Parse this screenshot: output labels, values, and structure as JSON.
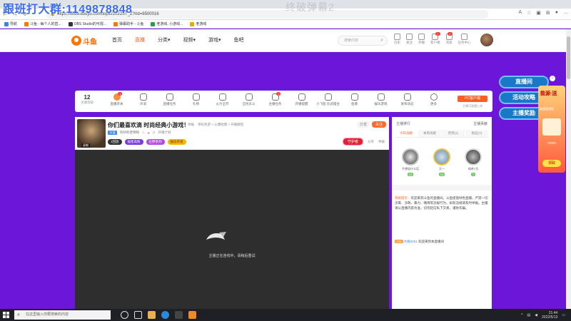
{
  "overlay": {
    "title": "跟班打大群:1149878848",
    "watermark": "终破弹幕2"
  },
  "browser": {
    "url": "https://www.douyu.com/topic/2022ST_Z?rid=8500016",
    "bookmarks": [
      "导航",
      "斗鱼 - 每个人的直...",
      "OBS Studio的可视...",
      "弹幕助手 - 斗鱼",
      "老游戏, 小游戏...",
      "老游戏"
    ]
  },
  "header": {
    "logo_text": "斗鱼",
    "nav": [
      "首页",
      "直播",
      "分类▾",
      "视频▾",
      "游戏▾",
      "鱼吧"
    ],
    "search_placeholder": "搜索内容",
    "user_icons": [
      {
        "label": "历史",
        "badge": ""
      },
      {
        "label": "关注",
        "badge": ""
      },
      {
        "label": "开播",
        "badge": ""
      },
      {
        "label": "客户端",
        "badge": "1"
      },
      {
        "label": "消息",
        "badge": "2"
      },
      {
        "label": "任务中心",
        "badge": ""
      }
    ]
  },
  "side": {
    "buttons": [
      "直播间",
      "活动攻略",
      "主播奖励"
    ],
    "close": "−",
    "promo_title": "能源·送",
    "promo_sub": "能量值领取",
    "promo_count": "0/300",
    "promo_button": "领取"
  },
  "toolbar": {
    "level_num": "12",
    "level_label": "主播等级",
    "items": [
      {
        "label": "直播开关",
        "badge": "1"
      },
      {
        "label": "声浪",
        "badge": ""
      },
      {
        "label": "直播任务",
        "badge": ""
      },
      {
        "label": "礼物",
        "badge": ""
      },
      {
        "label": "火力全开",
        "badge": ""
      },
      {
        "label": "全民乐斗",
        "badge": ""
      },
      {
        "label": "主播任务",
        "badge": "1"
      },
      {
        "label": "开播提醒",
        "badge": ""
      },
      {
        "label": "小飞船 比武擂台",
        "badge": ""
      },
      {
        "label": "鱼塘",
        "badge": ""
      },
      {
        "label": "娱乐游戏",
        "badge": ""
      },
      {
        "label": "发布动态",
        "badge": ""
      },
      {
        "label": "更多",
        "badge": ""
      }
    ],
    "pc_button": "PC客户端",
    "pc_sub": "主播可直播上线"
  },
  "room": {
    "title": "你们最喜欢滴 时尚经典小游戏！",
    "meta": [
      "举报",
      "单机热游 > 火爆经典 > 开箱教程"
    ],
    "tag": "认证",
    "anchor": "吵吵的老师呀",
    "heat": "8",
    "status": "开播计划",
    "avatar_tag": "录制",
    "pills": [
      "1回放",
      "福星高照",
      "狂野系列",
      "娱乐开发"
    ],
    "share": "分享",
    "follow": "关注",
    "red_action": "守护者",
    "actions": [
      "分享",
      "举报"
    ]
  },
  "player": {
    "message": "主播正在连线中，请稍后重试"
  },
  "rightpanel": {
    "head_left": "主播排行",
    "head_right": "主播贡献",
    "tabs": [
      "今日贡献",
      "本周贡献",
      "贵宾(1)",
      "粉丝(7)"
    ],
    "ranks": [
      {
        "name": "不想说什么话",
        "level": "12"
      },
      {
        "name": "天一",
        "level": "14"
      },
      {
        "name": "绿茶1号",
        "level": "7"
      }
    ],
    "notice_prefix": "系统提示：",
    "notice": "欢迎来到斗鱼的直播间。斗鱼提倡绿色直播，严禁一切涉黄、涉政、暴力、赌博等违规行为，如有违规请及时举报。主播请以直播内容为准，切勿轻信私下交易，谨防诈骗。",
    "welcome_level": "126",
    "welcome_name": "水瓶0001",
    "welcome_text": "欢迎来到本直播间"
  },
  "taskbar": {
    "search": "在这里输入你要搜索的内容",
    "time": "21:44",
    "date": "2022/5/13"
  }
}
